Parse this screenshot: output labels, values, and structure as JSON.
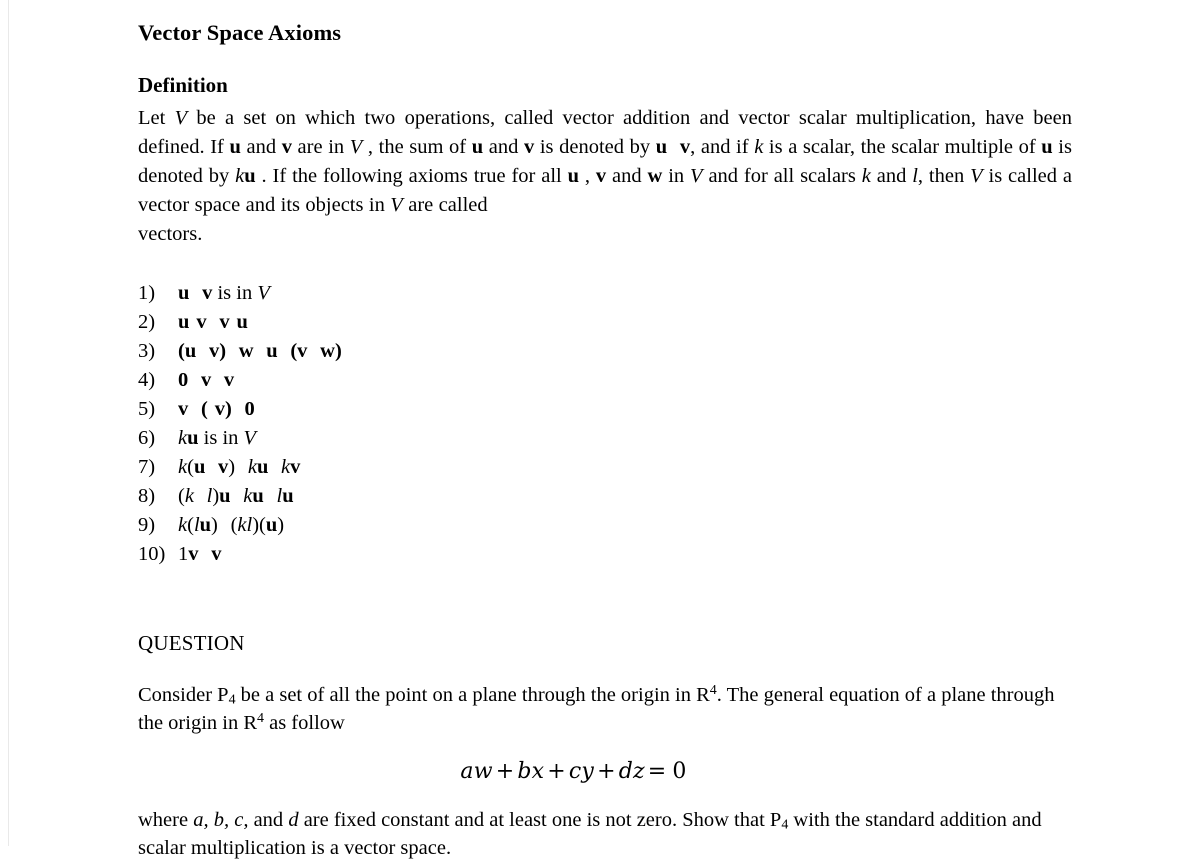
{
  "document": {
    "title": "Vector Space Axioms",
    "section_heading": "Definition",
    "definition": {
      "p1": "Let ",
      "V1": "V",
      "p2": " be a set on which two operations, called vector addition and vector scalar multiplication, have been defined. If ",
      "u1": "u",
      "p3": " and ",
      "v1": "v",
      "p4": " are in ",
      "V2": "V",
      "p5": " , the sum of ",
      "u2": "u",
      "p6": " and ",
      "v2": "v",
      "p7": " is denoted by ",
      "u3": "u",
      "v3": "v",
      "p8": ", and if ",
      "k1": "k",
      "p9": " is a scalar, the scalar multiple of ",
      "u4": "u",
      "p10": " is denoted by ",
      "k2": "k",
      "u5": "u",
      "p11": " . If the following axioms true for all ",
      "u6": "u",
      "p12": " , ",
      "v4": "v",
      "p13": " and ",
      "w1": "w",
      "p14": " in ",
      "V3": "V",
      "p15": " and for all scalars ",
      "k3": "k",
      "p16": " and ",
      "l1": "l",
      "p17": ", then ",
      "V4": "V",
      "p18": " is called a vector space and its objects in ",
      "V5": "V",
      "p19": " are called",
      "p20": "vectors."
    },
    "axioms": [
      {
        "number": "1)",
        "parts": [
          {
            "t": "u",
            "s": "vec"
          },
          {
            "t": "",
            "s": "gap"
          },
          {
            "t": "v",
            "s": "vec"
          },
          {
            "t": " is in ",
            "s": "plain"
          },
          {
            "t": "V",
            "s": "it"
          }
        ]
      },
      {
        "number": "2)",
        "parts": [
          {
            "t": "u",
            "s": "vec"
          },
          {
            "t": "",
            "s": "gap-sm"
          },
          {
            "t": "v",
            "s": "vec"
          },
          {
            "t": "",
            "s": "gap"
          },
          {
            "t": "v",
            "s": "vec"
          },
          {
            "t": "",
            "s": "gap-sm"
          },
          {
            "t": "u",
            "s": "vec"
          }
        ]
      },
      {
        "number": "3)",
        "parts": [
          {
            "t": "(",
            "s": "vec"
          },
          {
            "t": "u",
            "s": "vec"
          },
          {
            "t": "",
            "s": "gap"
          },
          {
            "t": "v",
            "s": "vec"
          },
          {
            "t": ")",
            "s": "vec"
          },
          {
            "t": "",
            "s": "gap"
          },
          {
            "t": "w",
            "s": "vec"
          },
          {
            "t": "",
            "s": "gap"
          },
          {
            "t": "u",
            "s": "vec"
          },
          {
            "t": "",
            "s": "gap"
          },
          {
            "t": "(",
            "s": "vec"
          },
          {
            "t": "v",
            "s": "vec"
          },
          {
            "t": "",
            "s": "gap"
          },
          {
            "t": "w",
            "s": "vec"
          },
          {
            "t": ")",
            "s": "vec"
          }
        ]
      },
      {
        "number": "4)",
        "parts": [
          {
            "t": "0",
            "s": "vec"
          },
          {
            "t": "",
            "s": "gap"
          },
          {
            "t": "v",
            "s": "vec"
          },
          {
            "t": "",
            "s": "gap"
          },
          {
            "t": "v",
            "s": "vec"
          }
        ]
      },
      {
        "number": "5)",
        "parts": [
          {
            "t": "v",
            "s": "vec"
          },
          {
            "t": "",
            "s": "gap"
          },
          {
            "t": "(",
            "s": "vec"
          },
          {
            "t": "",
            "s": "gap-sm"
          },
          {
            "t": "v",
            "s": "vec"
          },
          {
            "t": ")",
            "s": "vec"
          },
          {
            "t": "",
            "s": "gap"
          },
          {
            "t": "0",
            "s": "vec"
          }
        ]
      },
      {
        "number": "6)",
        "parts": [
          {
            "t": "k",
            "s": "it"
          },
          {
            "t": "u",
            "s": "vec"
          },
          {
            "t": " is in ",
            "s": "plain"
          },
          {
            "t": "V",
            "s": "it"
          }
        ]
      },
      {
        "number": "7)",
        "parts": [
          {
            "t": "k",
            "s": "it"
          },
          {
            "t": "(",
            "s": "plain"
          },
          {
            "t": "u",
            "s": "vec"
          },
          {
            "t": "",
            "s": "gap"
          },
          {
            "t": "v",
            "s": "vec"
          },
          {
            "t": ")",
            "s": "plain"
          },
          {
            "t": "",
            "s": "gap"
          },
          {
            "t": "k",
            "s": "it"
          },
          {
            "t": "u",
            "s": "vec"
          },
          {
            "t": "",
            "s": "gap"
          },
          {
            "t": "k",
            "s": "it"
          },
          {
            "t": "v",
            "s": "vec"
          }
        ]
      },
      {
        "number": "8)",
        "parts": [
          {
            "t": "(",
            "s": "plain"
          },
          {
            "t": "k",
            "s": "it"
          },
          {
            "t": "",
            "s": "gap"
          },
          {
            "t": "l",
            "s": "it"
          },
          {
            "t": ")",
            "s": "plain"
          },
          {
            "t": "u",
            "s": "vec"
          },
          {
            "t": "",
            "s": "gap"
          },
          {
            "t": "k",
            "s": "it"
          },
          {
            "t": "u",
            "s": "vec"
          },
          {
            "t": "",
            "s": "gap"
          },
          {
            "t": "l",
            "s": "it"
          },
          {
            "t": "u",
            "s": "vec"
          }
        ]
      },
      {
        "number": "9)",
        "parts": [
          {
            "t": "k",
            "s": "it"
          },
          {
            "t": "(",
            "s": "plain"
          },
          {
            "t": "l",
            "s": "it"
          },
          {
            "t": "u",
            "s": "vec"
          },
          {
            "t": ")",
            "s": "plain"
          },
          {
            "t": "",
            "s": "gap"
          },
          {
            "t": "(",
            "s": "plain"
          },
          {
            "t": "k",
            "s": "it"
          },
          {
            "t": "l",
            "s": "it"
          },
          {
            "t": ")(",
            "s": "plain"
          },
          {
            "t": "u",
            "s": "vec"
          },
          {
            "t": ")",
            "s": "plain"
          }
        ]
      },
      {
        "number": "10)",
        "parts": [
          {
            "t": "1",
            "s": "plain"
          },
          {
            "t": "v",
            "s": "vec"
          },
          {
            "t": "",
            "s": "gap"
          },
          {
            "t": "v",
            "s": "vec"
          }
        ]
      }
    ],
    "question": {
      "heading": "QUESTION",
      "body_a": "Consider P",
      "body_a_sub": "4",
      "body_b": " be a set of all the point on a plane through the origin in R",
      "body_b_sup": "4",
      "body_c": ". The general equation of a plane through the origin in R",
      "body_c_sup": "4",
      "body_d": " as follow",
      "equation": {
        "term1": "aw",
        "op1": "+",
        "term2": "bx",
        "op2": "+",
        "term3": "cy",
        "op3": "+",
        "term4": "dz",
        "op4": "=",
        "rhs": "0",
        "full": "aw + bx + cy + dz = 0"
      },
      "closing_a": "where ",
      "closing_abc": "a, b, c,",
      "closing_b": " and ",
      "closing_d": "d",
      "closing_c": " are fixed constant and at least one is not zero. Show that P",
      "closing_c_sub": "4",
      "closing_e": " with the standard addition and scalar multiplication is a vector space."
    }
  }
}
